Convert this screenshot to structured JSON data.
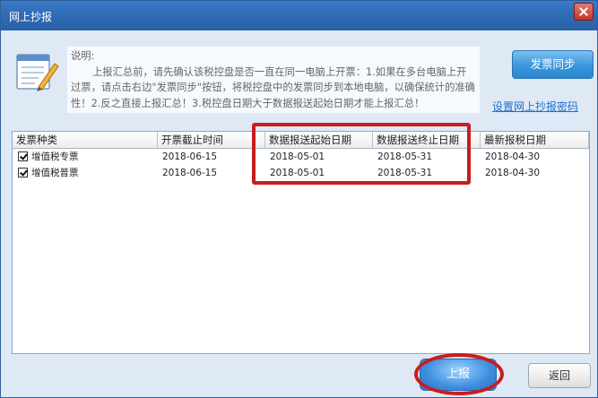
{
  "window": {
    "title": "网上抄报"
  },
  "info": {
    "label": "说明:",
    "text": "上报汇总前，请先确认该税控盘是否一直在同一电脑上开票：1.如果在多台电脑上开过票，请点击右边\"发票同步\"按钮，将税控盘中的发票同步到本地电脑，以确保统计的准确性！2.反之直接上报汇总！3.税控盘日期大于数据报送起始日期才能上报汇总！"
  },
  "buttons": {
    "sync": "发票同步",
    "report": "上报",
    "return": "返回"
  },
  "links": {
    "settings": "设置网上抄报密码"
  },
  "table": {
    "columns": [
      "发票种类",
      "开票截止时间",
      "数据报送起始日期",
      "数据报送终止日期",
      "最新报税日期"
    ],
    "rows": [
      {
        "type": "增值税专票",
        "deadline": "2018-06-15",
        "start": "2018-05-01",
        "end": "2018-05-31",
        "latest": "2018-04-30",
        "checked": true
      },
      {
        "type": "增值税普票",
        "deadline": "2018-06-15",
        "start": "2018-05-01",
        "end": "2018-05-31",
        "latest": "2018-04-30",
        "checked": true
      }
    ]
  },
  "icons": {
    "notepad": "notepad-pencil-icon",
    "close": "close-icon",
    "checkbox": "checkbox-checked-icon"
  },
  "colors": {
    "titlebar": "#2d69b3",
    "button_blue": "#3a96dc",
    "annotation_red": "#c81d1d",
    "link": "#1b6fd1"
  }
}
